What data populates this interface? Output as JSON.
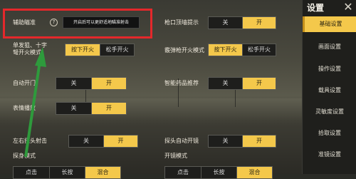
{
  "sidebar": {
    "title": "设置",
    "items": [
      {
        "label": "基础设置",
        "active": true
      },
      {
        "label": "画面设置",
        "active": false
      },
      {
        "label": "操作设置",
        "active": false
      },
      {
        "label": "载具设置",
        "active": false
      },
      {
        "label": "灵敏度设置",
        "active": false
      },
      {
        "label": "拾取设置",
        "active": false
      },
      {
        "label": "准镜设置",
        "active": false
      }
    ]
  },
  "settings": {
    "aim_assist": {
      "label": "辅助瞄准",
      "tooltip": "开启后可以更舒适地瞄准射击"
    },
    "muzzle_hint": {
      "label": "枪口顶墙提示",
      "off": "关",
      "on": "开"
    },
    "single_shot": {
      "label_line1": "单发狙、十字",
      "label_line2": "弩开火模式",
      "opt1": "按下开火",
      "opt2": "松手开火"
    },
    "shotgun_fire": {
      "label": "霰弹枪开火模式",
      "opt1": "按下开火",
      "opt2": "松手开火"
    },
    "auto_door": {
      "label": "自动开门",
      "off": "关",
      "on": "开"
    },
    "smart_med": {
      "label": "智能药品推荐",
      "off": "关",
      "on": "开"
    },
    "emote": {
      "label": "表情播放",
      "off": "关",
      "on": "开"
    },
    "peek_fire": {
      "label": "左右探头射击",
      "off": "关",
      "on": "开"
    },
    "peek_scope": {
      "label": "探头自动开镜",
      "off": "关",
      "on": "开"
    },
    "peek_mode": {
      "label": "探身模式",
      "opt1": "点击",
      "opt2": "长按",
      "opt3": "混合"
    },
    "scope_mode": {
      "label": "开镜模式",
      "opt1": "点击",
      "opt2": "长按",
      "opt3": "混合"
    }
  },
  "colors": {
    "accent": "#f4c84b",
    "annotation_box": "#e4282b",
    "annotation_arrow": "#2e9a3c"
  }
}
